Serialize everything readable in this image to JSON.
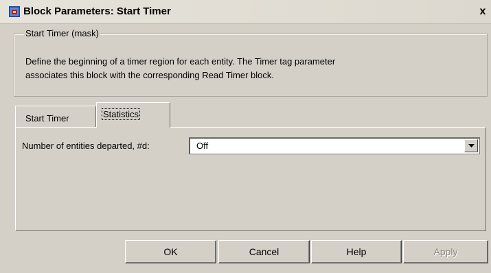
{
  "window": {
    "title": "Block Parameters: Start Timer",
    "close_label": "x"
  },
  "mask": {
    "legend": "Start Timer (mask)",
    "description": "Define the beginning of a timer region for each entity. The Timer tag parameter\nassociates this block with the corresponding Read Timer block."
  },
  "tabs": [
    {
      "label": "Start Timer",
      "selected": false
    },
    {
      "label": "Statistics",
      "selected": true
    }
  ],
  "statistics": {
    "departed_label": "Number of entities departed, #d:",
    "departed_value": "Off"
  },
  "buttons": {
    "ok": "OK",
    "cancel": "Cancel",
    "help": "Help",
    "apply": "Apply"
  },
  "icons": {
    "title": "simulink-block-icon",
    "dropdown": "chevron-down-icon"
  },
  "colors": {
    "dialog_bg": "#d4d0c8",
    "field_bg": "#ffffff",
    "disabled_text": "#8a877f"
  }
}
